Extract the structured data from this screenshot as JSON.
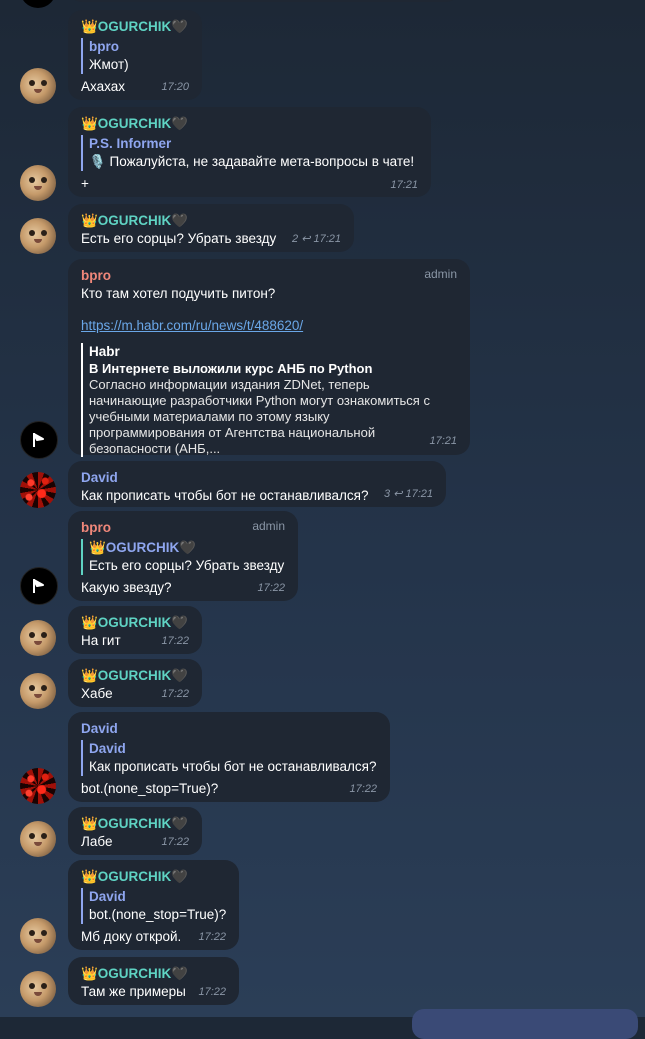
{
  "messages": [
    {
      "sender": "👑OGURCHIK🖤",
      "reply_name": "bpro",
      "reply_text": "Жмот)",
      "text": "Ахахах",
      "time": "17:20"
    },
    {
      "sender": "👑OGURCHIK🖤",
      "reply_name": "P.S. Informer",
      "reply_text": "🎙️ Пожалуйста, не задавайте мета-вопросы в чате!",
      "text": "+",
      "time": "17:21"
    },
    {
      "sender": "👑OGURCHIK🖤",
      "text": "Есть его сорцы? Убрать звезду",
      "replies": "2",
      "time": "17:21"
    },
    {
      "sender": "bpro",
      "role": "admin",
      "text": "Кто там хотел подучить питон?",
      "link": "https://m.habr.com/ru/news/t/488620/",
      "preview_site": "Habr",
      "preview_title": "В Интернете выложили курс АНБ по Python",
      "preview_desc": [
        "Согласно информации издания ZDNet, теперь",
        "начинающие разработчики Python могут ознакомиться с",
        "учебными материалами по этому языку",
        "программирования от Агентства национальной",
        "безопасности (АНБ,..."
      ],
      "time": "17:21"
    },
    {
      "sender": "David",
      "text": "Как прописать чтобы бот не останавливался?",
      "replies": "3",
      "time": "17:21"
    },
    {
      "sender": "bpro",
      "role": "admin",
      "reply_name": "👑OGURCHIK🖤",
      "reply_text": "Есть его сорцы? Убрать звезду",
      "text": "Какую звезду?",
      "time": "17:22"
    },
    {
      "sender": "👑OGURCHIK🖤",
      "text": "На гит",
      "time": "17:22"
    },
    {
      "sender": "👑OGURCHIK🖤",
      "text": "Хабе",
      "time": "17:22"
    },
    {
      "sender": "David",
      "reply_name": "David",
      "reply_text": "Как прописать чтобы бот не останавливался?",
      "text": "bot.(none_stop=True)?",
      "time": "17:22"
    },
    {
      "sender": "👑OGURCHIK🖤",
      "text": "Лабе",
      "time": "17:22"
    },
    {
      "sender": "👑OGURCHIK🖤",
      "reply_name": "David",
      "reply_text": "bot.(none_stop=True)?",
      "text": "Мб доку открой.",
      "time": "17:22"
    },
    {
      "sender": "👑OGURCHIK🖤",
      "text": "Там же примеры",
      "time": "17:22"
    }
  ],
  "colors": {
    "ogurchik": "#5fd3c3",
    "bpro": "#f0877a",
    "david": "#8fa6ef",
    "bubble": "#1f2733",
    "link": "#6aa7e8"
  },
  "icons": {
    "avatar_ogurchik": "cat-avatar",
    "avatar_bpro": "arrow-flag-avatar",
    "avatar_david": "red-pattern-avatar",
    "reply_arrow": "reply-arrow-icon"
  }
}
